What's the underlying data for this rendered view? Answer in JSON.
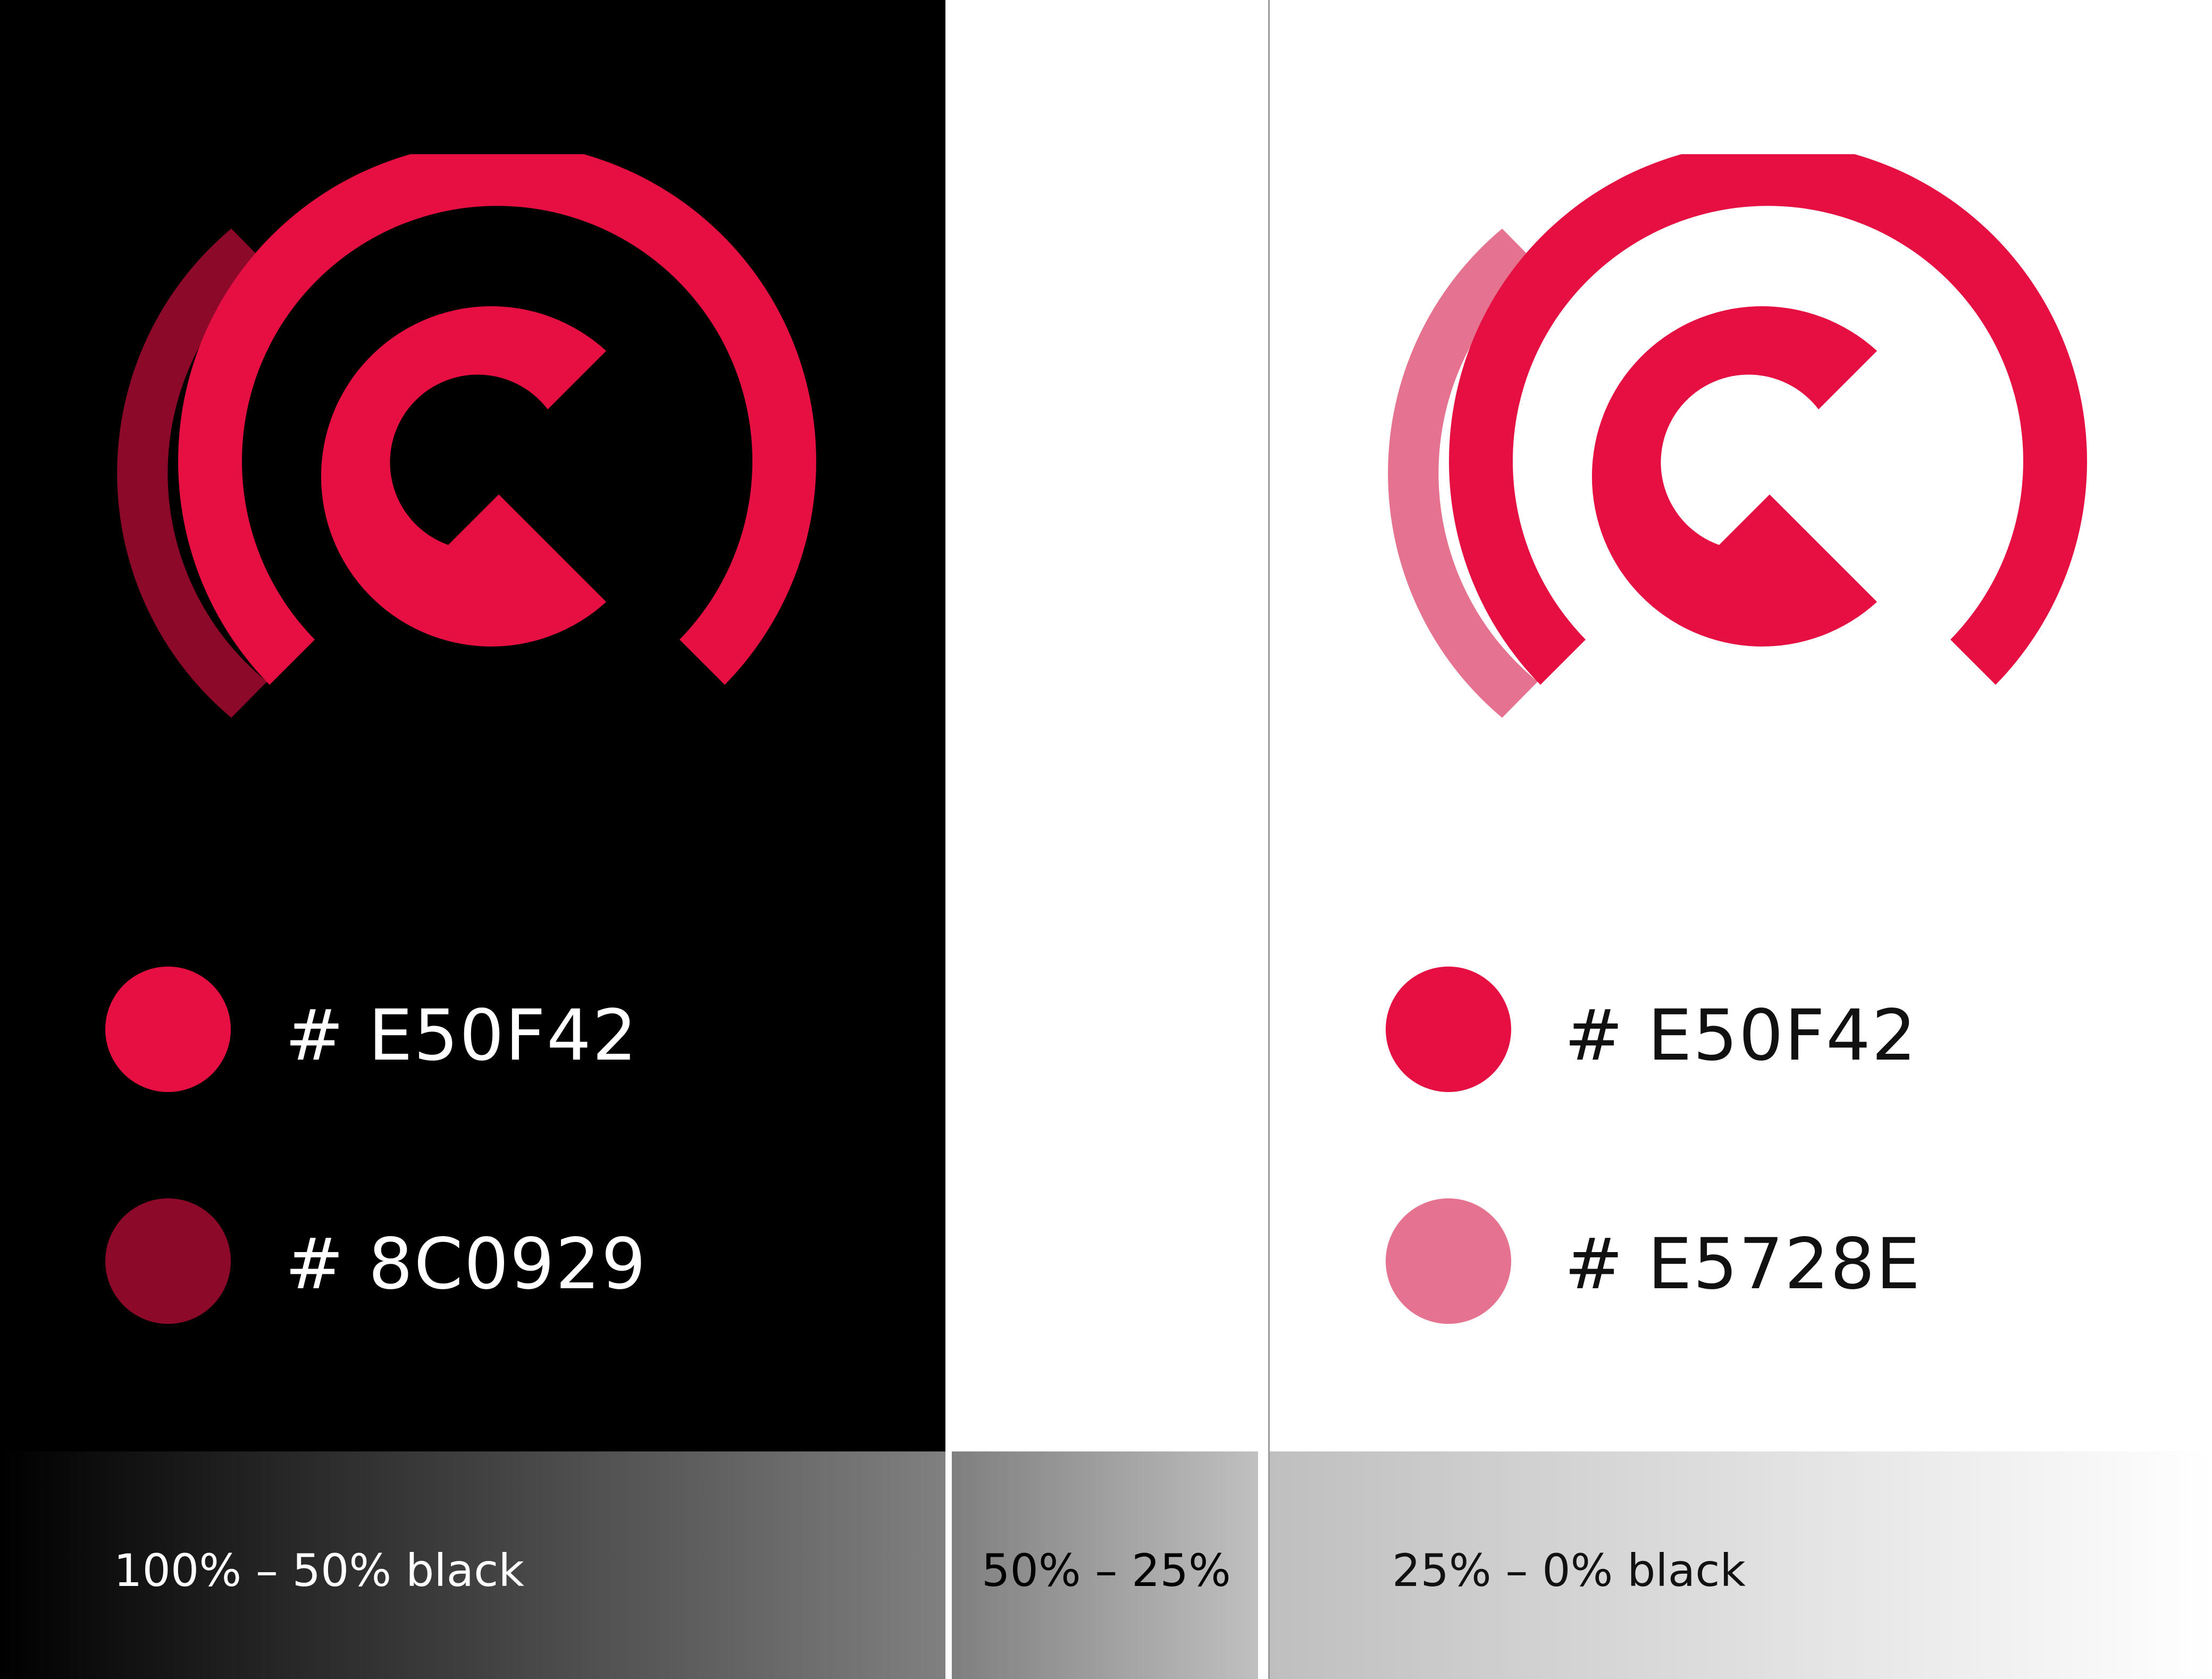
{
  "colors": {
    "primary": "#E50F42",
    "dark_shade": "#8C0929",
    "light_shade": "#E5728E",
    "background_dark": "#000000",
    "background_light": "#FFFFFF"
  },
  "dark_panel": {
    "swatches": [
      {
        "label": "# E50F42",
        "color": "#E50F42"
      },
      {
        "label": "# 8C0929",
        "color": "#8C0929"
      }
    ]
  },
  "light_panel": {
    "swatches": [
      {
        "label": "# E50F42",
        "color": "#E50F42"
      },
      {
        "label": "# E5728E",
        "color": "#E5728E"
      }
    ]
  },
  "gradient_bars": [
    {
      "label": "100% – 50% black"
    },
    {
      "label": "50% – 25%"
    },
    {
      "label": "25% – 0% black"
    }
  ]
}
